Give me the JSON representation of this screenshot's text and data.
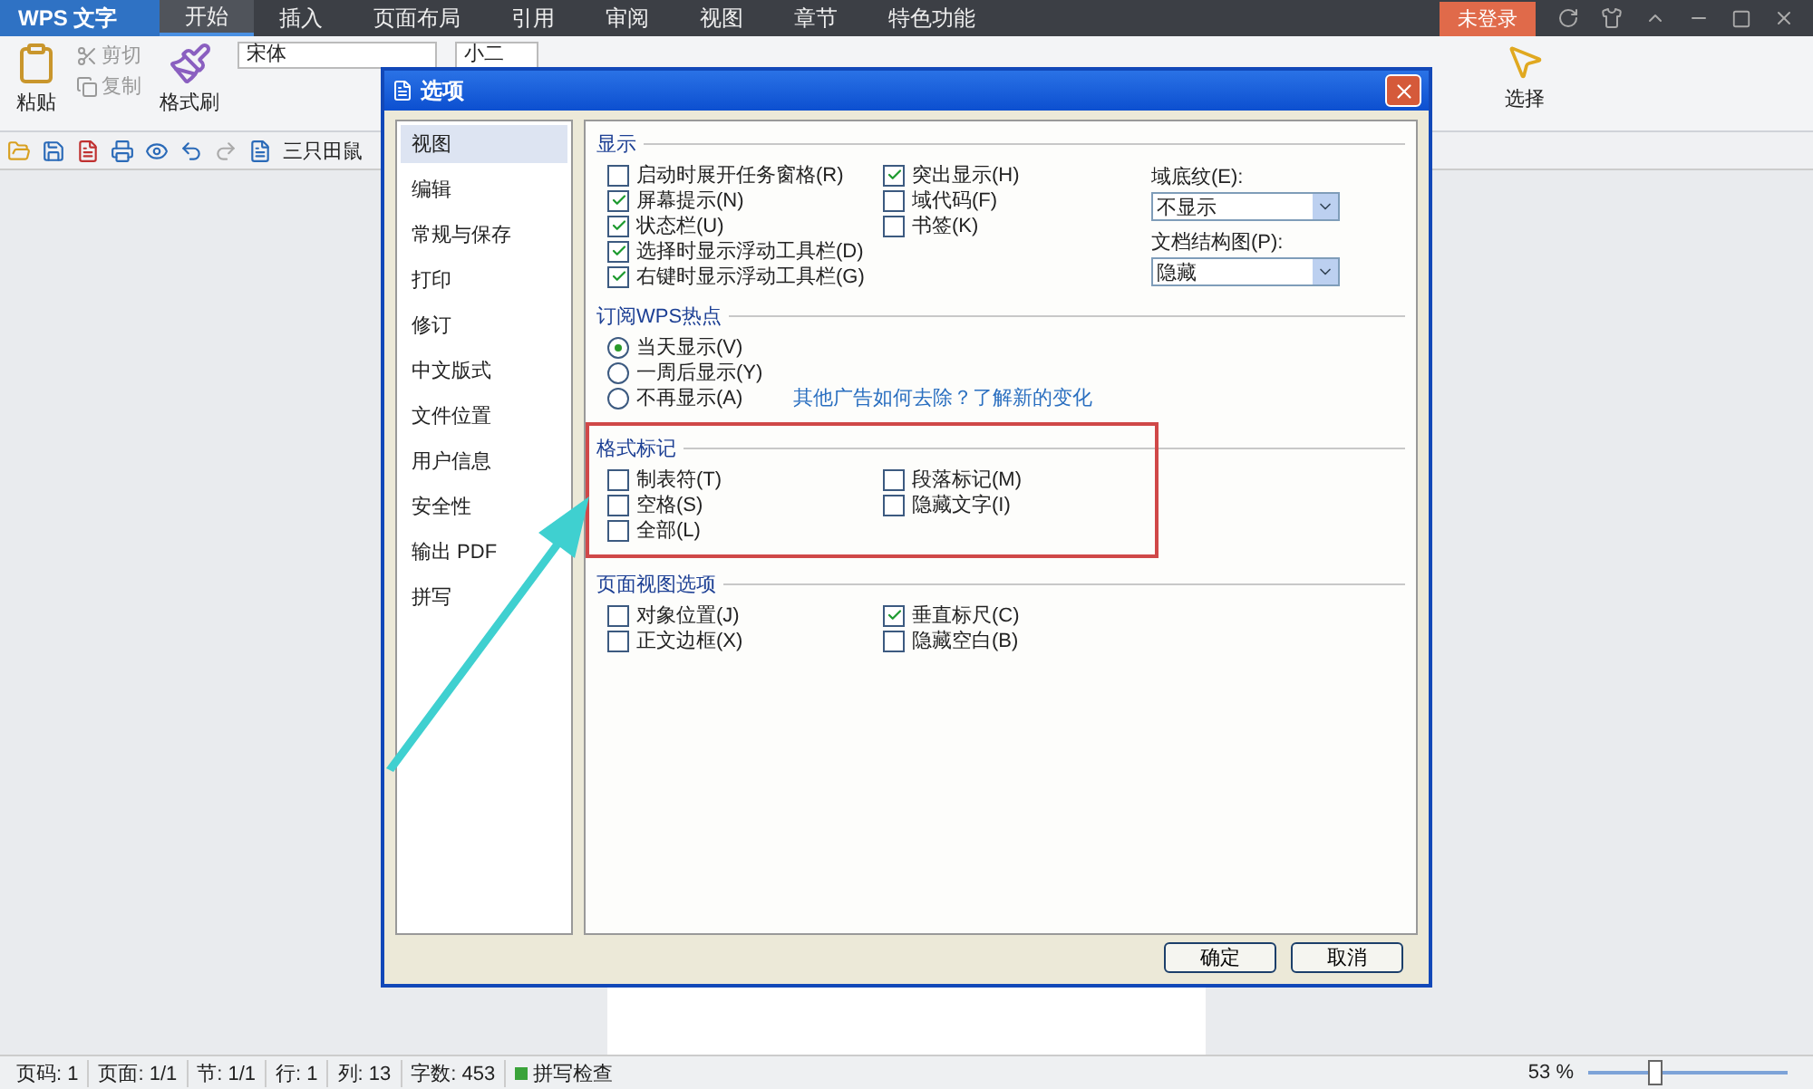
{
  "app": {
    "menu_button": "WPS 文字",
    "tabs": [
      {
        "label": "开始",
        "selected": true
      },
      {
        "label": "插入",
        "selected": false
      },
      {
        "label": "页面布局",
        "selected": false
      },
      {
        "label": "引用",
        "selected": false
      },
      {
        "label": "审阅",
        "selected": false
      },
      {
        "label": "视图",
        "selected": false
      },
      {
        "label": "章节",
        "selected": false
      },
      {
        "label": "特色功能",
        "selected": false
      }
    ],
    "login_badge": "未登录"
  },
  "ribbon": {
    "paste": "粘贴",
    "cut": "剪切",
    "copy": "复制",
    "format_painter": "格式刷",
    "font_name": "宋体",
    "font_size": "小二",
    "select": "选择"
  },
  "quick_bar": {
    "document_tab": "三只田鼠"
  },
  "status_bar": {
    "items": [
      "页码: 1",
      "页面: 1/1",
      "节: 1/1",
      "行: 1",
      "列: 13",
      "字数: 453"
    ],
    "spell_check": "拼写检查",
    "zoom": "53 %",
    "zoom_level": {
      "level": 0.3
    }
  },
  "dialog": {
    "title": "选项",
    "nav": [
      {
        "label": "视图",
        "selected": true
      },
      {
        "label": "编辑",
        "selected": false
      },
      {
        "label": "常规与保存",
        "selected": false
      },
      {
        "label": "打印",
        "selected": false
      },
      {
        "label": "修订",
        "selected": false
      },
      {
        "label": "中文版式",
        "selected": false
      },
      {
        "label": "文件位置",
        "selected": false
      },
      {
        "label": "用户信息",
        "selected": false
      },
      {
        "label": "安全性",
        "selected": false
      },
      {
        "label": "输出 PDF",
        "selected": false
      },
      {
        "label": "拼写",
        "selected": false
      }
    ],
    "display": {
      "title": "显示",
      "columns": [
        [
          {
            "label": "启动时展开任务窗格(R)",
            "checked": false
          },
          {
            "label": "屏幕提示(N)",
            "checked": true
          },
          {
            "label": "状态栏(U)",
            "checked": true
          },
          {
            "label": "选择时显示浮动工具栏(D)",
            "checked": true
          },
          {
            "label": "右键时显示浮动工具栏(G)",
            "checked": true
          }
        ],
        [
          {
            "label": "突出显示(H)",
            "checked": true
          },
          {
            "label": "域代码(F)",
            "checked": false
          },
          {
            "label": "书签(K)",
            "checked": false
          }
        ]
      ],
      "selects": [
        {
          "label": "域底纹(E):",
          "value": "不显示"
        },
        {
          "label": "文档结构图(P):",
          "value": "隐藏"
        }
      ]
    },
    "hotspot": {
      "title": "订阅WPS热点",
      "options": [
        {
          "label": "当天显示(V)",
          "selected": true
        },
        {
          "label": "一周后显示(Y)",
          "selected": false
        },
        {
          "label": "不再显示(A)",
          "selected": false
        }
      ],
      "link": "其他广告如何去除？了解新的变化"
    },
    "format_marks": {
      "title": "格式标记",
      "columns": [
        [
          {
            "label": "制表符(T)",
            "checked": false
          },
          {
            "label": "空格(S)",
            "checked": false
          },
          {
            "label": "全部(L)",
            "checked": false
          }
        ],
        [
          {
            "label": "段落标记(M)",
            "checked": false
          },
          {
            "label": "隐藏文字(I)",
            "checked": false
          }
        ]
      ]
    },
    "page_view": {
      "title": "页面视图选项",
      "columns": [
        [
          {
            "label": "对象位置(J)",
            "checked": false
          },
          {
            "label": "正文边框(X)",
            "checked": false
          }
        ],
        [
          {
            "label": "垂直标尺(C)",
            "checked": true
          },
          {
            "label": "隐藏空白(B)",
            "checked": false
          }
        ]
      ]
    },
    "buttons": [
      "确定",
      "取消"
    ]
  }
}
